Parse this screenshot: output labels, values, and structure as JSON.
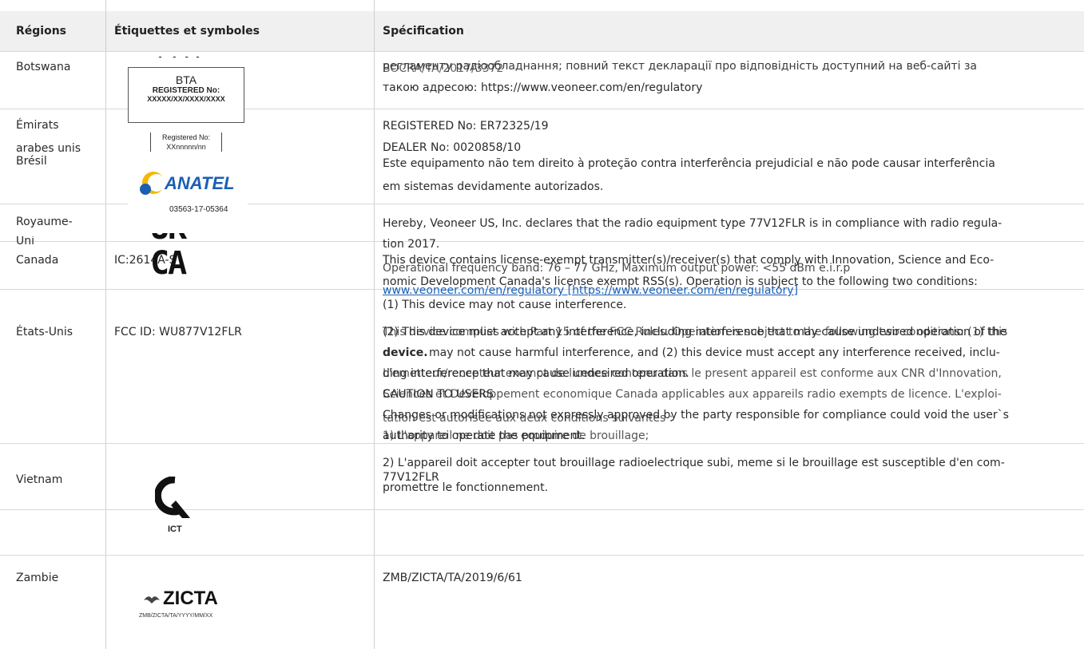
{
  "header": {
    "col_regions": "Régions",
    "col_labels": "Étiquettes et symboles",
    "col_spec": "Spécification"
  },
  "rows": {
    "botswana": {
      "region": "Botswana",
      "logo_title": "BTA",
      "logo_reg": "REGISTERED No:",
      "logo_code": "XXXXX/XX/XXXX/XXXX",
      "spec_line1_a": "регламенту радіообладнання; повний текст декларації про відповідність доступний на веб-сайті за",
      "spec_line1_b": "BOCRA/TA/2017/3372",
      "spec_line2": "такою адресою: https://www.veoneer.com/en/regulatory"
    },
    "emirates": {
      "region_1": "Émirats",
      "region_2": "arabes unis",
      "logo_reg": "Registered No:",
      "logo_code": "XXnnnnn/nn",
      "spec_line1": "REGISTERED No: ER72325/19",
      "spec_line2": "DEALER No: 0020858/10"
    },
    "brazil": {
      "region": "Brésil",
      "logo_brand": "ANATEL",
      "logo_code": "03563-17-05364",
      "spec_line1": "Este equipamento não tem direito à proteção contra interferência prejudicial e não pode causar interferência",
      "spec_line2": "em sistemas devidamente autorizados."
    },
    "uk": {
      "region_1": "Royaume-",
      "region_2": "Uni",
      "logo_top": "UK",
      "logo_bottom": "CA",
      "spec_line1": "Hereby, Veoneer US, Inc. declares that the radio equipment type 77V12FLR is in compliance with radio regula-",
      "spec_line2": "tion 2017."
    },
    "canada": {
      "region": "Canada",
      "label": "IC:2614A-S",
      "spec_line1_a": "This device contains license-exempt transmitter(s)/receiver(s) that comply with Innovation, Science and Eco-",
      "spec_line1_b": "Operational frequency band: 76 – 77 GHz, Maximum output power: <55 dBm e.i.r.p",
      "spec_line2": "nomic Development Canada's license exempt RSS(s). Operation is subject to the following two conditions:",
      "spec_link": "www.veoneer.com/en/regulatory [https://www.veoneer.com/en/regulatory]",
      "spec_line3": "(1) This device may not cause interference."
    },
    "usa": {
      "region": "États-Unis",
      "label": "FCC ID: WU877V12FLR",
      "spec_line1_a": "(2) This device must accept any interference, including interference that may cause undesired operation of the",
      "spec_line1_b": "This device complies with Part 15 of the FCC Rules. Operation is subject to the following two conditions: (1) this",
      "spec_line2_bold": "device.",
      "spec_line2": "may not cause harmful interference, and (2) this device must accept any interference received, inclu-",
      "spec_line3_a": "ding interference that may cause undesired operation.",
      "spec_line3_b": "L'emetteur/recepteur exempt de licence contenu dans le present appareil est conforme aux CNR d'Innovation,",
      "spec_line4_a": "CAUTION TO USERS",
      "spec_line4_b": "Sciences et Developpement economique Canada applicables aux appareils radio exempts de licence. L'exploi-",
      "spec_line5_a": "Changes or modifications not expressly approved by the party responsible for compliance could void the user`s",
      "spec_line5_b": "tation est autorisee aux deux conditions suivantes :",
      "spec_line6_a": "authority to operate the equipment.",
      "spec_line6_b": "1) L'appareil ne doit pas produire de brouillage;",
      "spec_line7": "2) L'appareil doit accepter tout brouillage radioelectrique subi, meme si le brouillage est susceptible d'en com-",
      "spec_line8_a": "77V12FLR",
      "spec_line8_b": "promettre le fonctionnement."
    },
    "vietnam": {
      "region": "Vietnam",
      "logo_text": "ICT"
    },
    "zambia": {
      "region": "Zambie",
      "logo_brand": "ZICTA",
      "logo_code": "ZMB/ZICTA/TA/YYYY/MM/XX",
      "spec_line1": "ZMB/ZICTA/TA/2019/6/61"
    }
  },
  "colors": {
    "header_bg": "#f0f0f0",
    "anatel_yellow": "#f5b800",
    "anatel_blue": "#1a5fb4",
    "link": "#1a5fb4"
  }
}
